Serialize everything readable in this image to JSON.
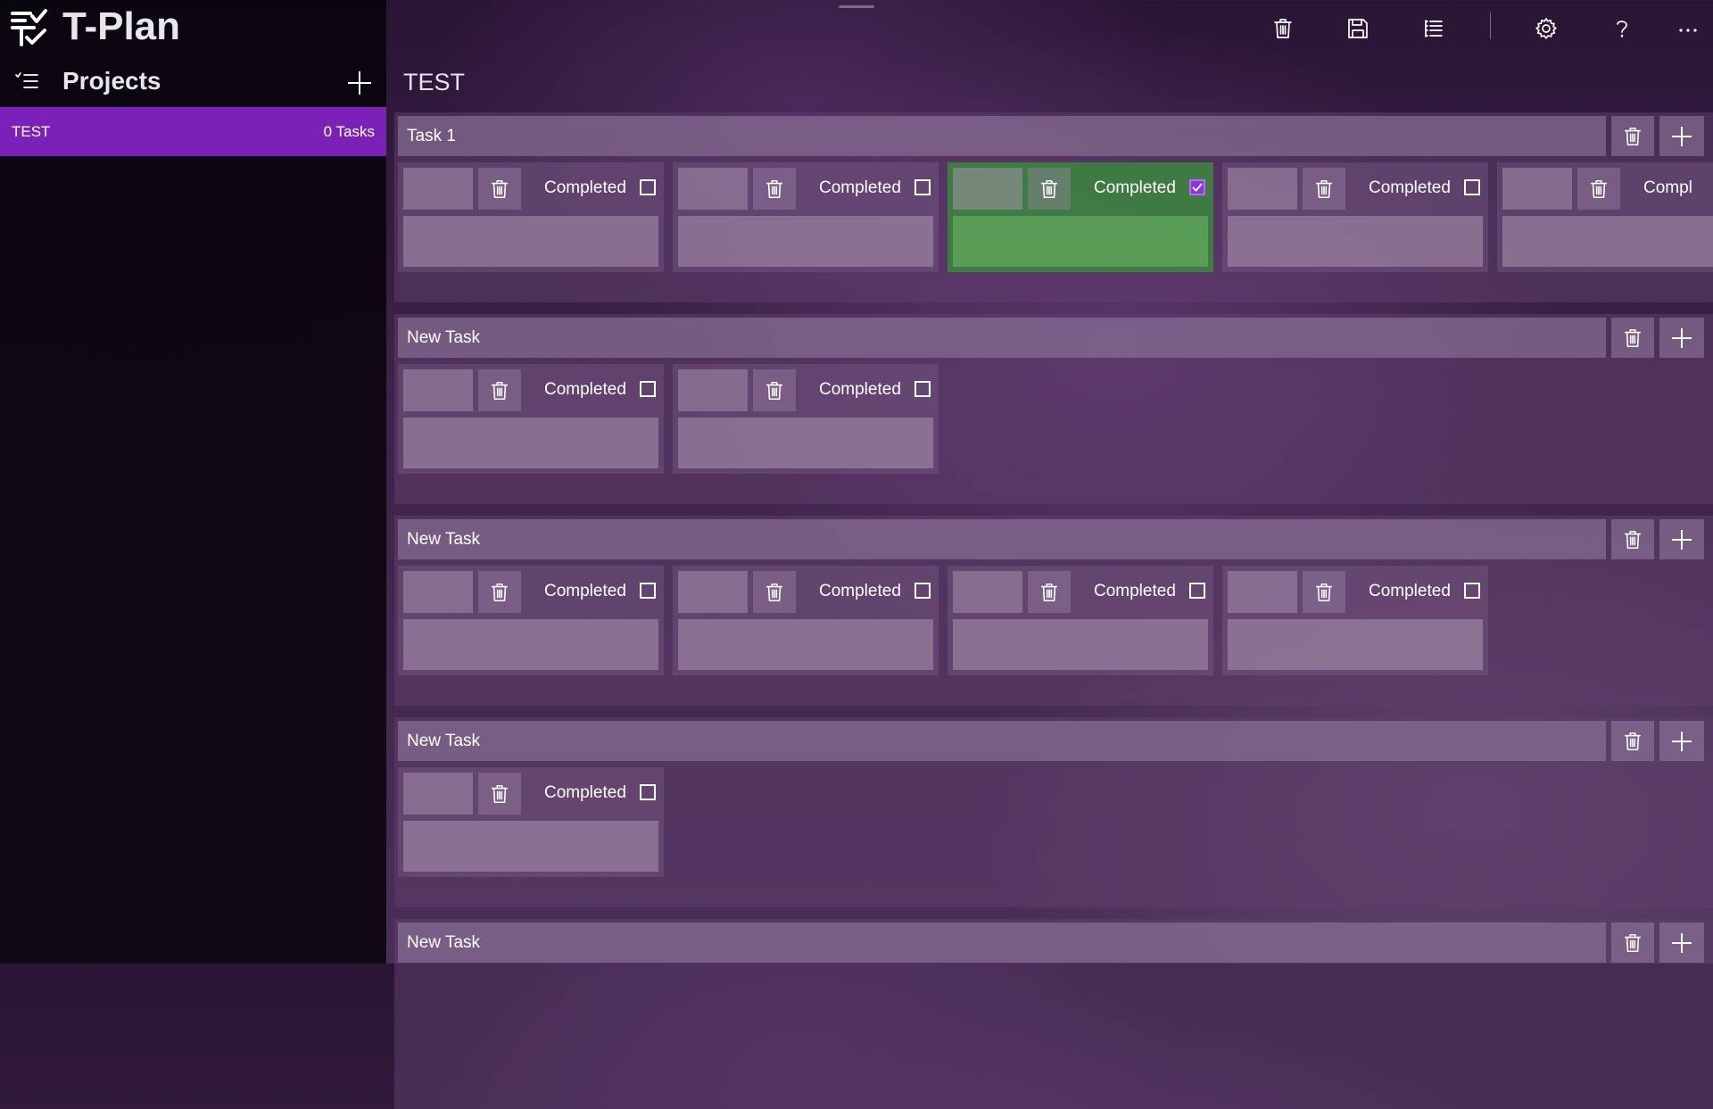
{
  "app": {
    "title": "T-Plan"
  },
  "sidebar": {
    "heading": "Projects",
    "projects": [
      {
        "name": "TEST",
        "count": "0 Tasks"
      }
    ]
  },
  "toolbar": {
    "items": [
      "trash-icon",
      "save-icon",
      "list-icon",
      "settings-icon",
      "help-icon",
      "more-icon"
    ]
  },
  "main": {
    "project_title": "TEST",
    "groups": [
      {
        "title": "Task 1",
        "cards": [
          {
            "label": "Completed",
            "checked": false
          },
          {
            "label": "Completed",
            "checked": false
          },
          {
            "label": "Completed",
            "checked": true
          },
          {
            "label": "Completed",
            "checked": false
          },
          {
            "label": "Compl",
            "checked": false
          }
        ]
      },
      {
        "title": "New Task",
        "cards": [
          {
            "label": "Completed",
            "checked": false
          },
          {
            "label": "Completed",
            "checked": false
          }
        ]
      },
      {
        "title": "New Task",
        "cards": [
          {
            "label": "Completed",
            "checked": false
          },
          {
            "label": "Completed",
            "checked": false
          },
          {
            "label": "Completed",
            "checked": false
          },
          {
            "label": "Completed",
            "checked": false
          }
        ]
      },
      {
        "title": "New Task",
        "cards": [
          {
            "label": "Completed",
            "checked": false
          }
        ]
      },
      {
        "title": "New Task",
        "cards": []
      }
    ]
  },
  "colors": {
    "accent": "#7a22b8",
    "completed": "#379637",
    "checkbox_checked": "#8a35d8"
  }
}
